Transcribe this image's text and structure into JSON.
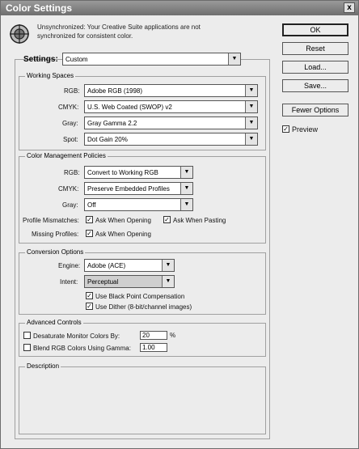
{
  "window": {
    "title": "Color Settings",
    "close_glyph": "x"
  },
  "sync": {
    "icon": "sync-globe-icon",
    "line1": "Unsynchronized: Your Creative Suite applications are not",
    "line2": "synchronized for consistent color."
  },
  "settings": {
    "label": "Settings:",
    "value": "Custom"
  },
  "working_spaces": {
    "title": "Working Spaces",
    "rgb_label": "RGB:",
    "rgb_value": "Adobe RGB (1998)",
    "cmyk_label": "CMYK:",
    "cmyk_value": "U.S. Web Coated (SWOP) v2",
    "gray_label": "Gray:",
    "gray_value": "Gray Gamma 2.2",
    "spot_label": "Spot:",
    "spot_value": "Dot Gain 20%"
  },
  "policies": {
    "title": "Color Management Policies",
    "rgb_label": "RGB:",
    "rgb_value": "Convert to Working RGB",
    "cmyk_label": "CMYK:",
    "cmyk_value": "Preserve Embedded Profiles",
    "gray_label": "Gray:",
    "gray_value": "Off",
    "mismatch_label": "Profile Mismatches:",
    "ask_opening_1": "Ask When Opening",
    "ask_opening_1_checked": true,
    "ask_pasting": "Ask When Pasting",
    "ask_pasting_checked": true,
    "missing_label": "Missing Profiles:",
    "ask_opening_2": "Ask When Opening",
    "ask_opening_2_checked": true
  },
  "conversion": {
    "title": "Conversion Options",
    "engine_label": "Engine:",
    "engine_value": "Adobe (ACE)",
    "intent_label": "Intent:",
    "intent_value": "Perceptual",
    "bpc_label": "Use Black Point Compensation",
    "bpc_checked": true,
    "dither_label": "Use Dither (8-bit/channel images)",
    "dither_checked": true
  },
  "advanced": {
    "title": "Advanced Controls",
    "desaturate_label": "Desaturate Monitor Colors By:",
    "desaturate_value": "20",
    "desaturate_unit": "%",
    "blend_label": "Blend RGB Colors Using Gamma:",
    "blend_value": "1.00"
  },
  "description": {
    "title": "Description"
  },
  "buttons": {
    "ok": "OK",
    "reset": "Reset",
    "load": "Load...",
    "save": "Save...",
    "fewer": "Fewer Options",
    "preview": "Preview",
    "preview_checked": true
  },
  "glyphs": {
    "check": "✓",
    "arrow": "▼"
  }
}
